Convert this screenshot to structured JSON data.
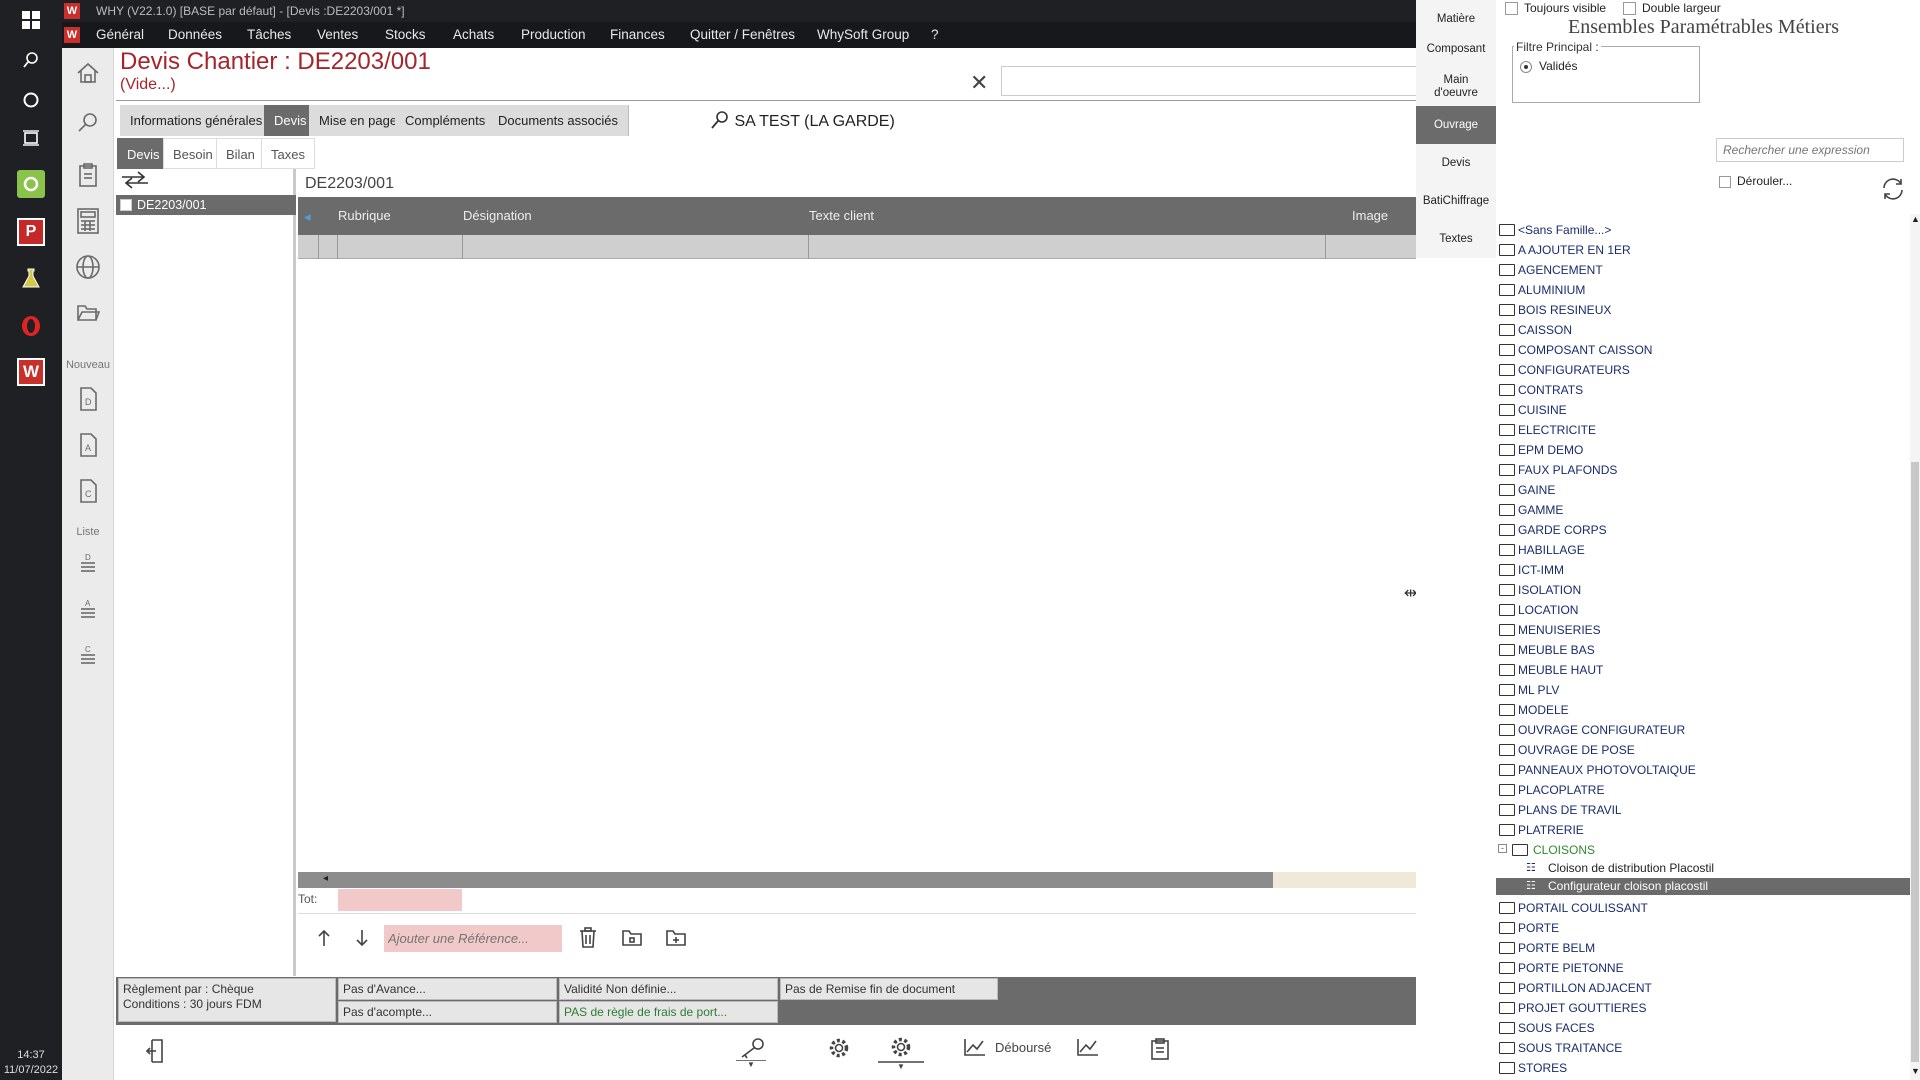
{
  "window": {
    "title": "WHY (V22.1.0)  [BASE par défaut] - [Devis :DE2203/001 *]"
  },
  "taskbar": {
    "time": "14:37",
    "date": "11/07/2022"
  },
  "menu": [
    "Général",
    "Données",
    "Tâches",
    "Ventes",
    "Stocks",
    "Achats",
    "Production",
    "Finances",
    "Quitter / Fenêtres",
    "WhySoft Group",
    "?"
  ],
  "sidebar": {
    "nouveau_label": "Nouveau",
    "liste_label": "Liste"
  },
  "header": {
    "title": "Devis  Chantier : DE2203/001",
    "subtitle": "(Vide...)",
    "client": "SA TEST  (LA GARDE)"
  },
  "tabs_main": [
    "Informations générales",
    "Devis",
    "Mise en page",
    "Compléments",
    "Documents associés"
  ],
  "tabs_sub": [
    "Devis",
    "Besoin",
    "Bilan",
    "Taxes"
  ],
  "tree": {
    "selected": "DE2203/001"
  },
  "grid": {
    "doc_label": "DE2203/001",
    "columns": [
      "Rubrique",
      "Désignation",
      "Texte client",
      "Image"
    ]
  },
  "totals": {
    "label": "Tot:"
  },
  "actions": {
    "ref_placeholder": "Ajouter une Référence..."
  },
  "footer": {
    "reglement": "Règlement par : Chèque",
    "conditions": "Conditions : 30 jours FDM",
    "avance": "Pas d'Avance...",
    "acompte": "Pas d'acompte...",
    "validite": "Validité Non définie...",
    "port": "PAS de règle de frais de port...",
    "remise": "Pas de Remise fin de document"
  },
  "bottom": {
    "debourse": "Déboursé"
  },
  "vtabs": [
    "Matière",
    "Composant",
    "Main d'oeuvre",
    "Ouvrage",
    "Devis",
    "BatiChiffrage",
    "Textes"
  ],
  "right_panel": {
    "toujours_visible": "Toujours visible",
    "double_largeur": "Double largeur",
    "title": "Ensembles Paramétrables Métiers",
    "filter_label": "Filtre Principal :",
    "filter_option": "Validés",
    "search_placeholder": "Rechercher une expression",
    "derouler": "Dérouler...",
    "families": [
      "<Sans Famille...>",
      "A AJOUTER EN 1ER",
      "AGENCEMENT",
      "ALUMINIUM",
      "BOIS RESINEUX",
      "CAISSON",
      "COMPOSANT CAISSON",
      "CONFIGURATEURS",
      "CONTRATS",
      "CUISINE",
      "ELECTRICITE",
      "EPM DEMO",
      "FAUX PLAFONDS",
      "GAINE",
      "GAMME",
      "GARDE CORPS",
      "HABILLAGE",
      "ICT-IMM",
      "ISOLATION",
      "LOCATION",
      "MENUISERIES",
      "MEUBLE BAS",
      "MEUBLE HAUT",
      "ML PLV",
      "MODELE",
      "OUVRAGE CONFIGURATEUR",
      "OUVRAGE DE POSE",
      "PANNEAUX PHOTOVOLTAIQUE",
      "PLACOPLATRE",
      "PLANS DE TRAVIL",
      "PLATRERIE"
    ],
    "expanded_group": "CLOISONS",
    "expanded_children": [
      "Cloison de distribution Placostil",
      "Configurateur cloison placostil"
    ],
    "families_after": [
      "PORTAIL COULISSANT",
      "PORTE",
      "PORTE BELM",
      "PORTE PIETONNE",
      "PORTILLON ADJACENT",
      "PROJET GOUTTIERES",
      "SOUS FACES",
      "SOUS TRAITANCE",
      "STORES"
    ]
  }
}
